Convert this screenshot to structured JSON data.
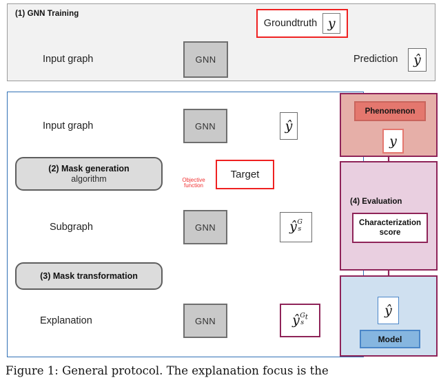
{
  "figure": {
    "caption": "Figure 1: General protocol. The explanation focus is the"
  },
  "panel1": {
    "title": "(1) GNN Training",
    "input_label": "Input graph",
    "gnn_label": "GNN",
    "groundtruth_label": "Groundtruth",
    "groundtruth_symbol": "y",
    "prediction_label": "Prediction",
    "prediction_symbol": "ŷ",
    "border_color": "#9a9a9a",
    "background": "#f2f2f2",
    "accent_color": "#ef2020"
  },
  "panel2": {
    "border_color": "#2f6fb5",
    "rows": [
      {
        "source_label": "Input graph",
        "gnn_label": "GNN",
        "output_symbol": "ŷ",
        "output_sup": ""
      },
      {
        "source_label": "Subgraph",
        "gnn_label": "GNN",
        "output_symbol": "ŷ",
        "output_sup": "G_s"
      },
      {
        "source_label": "Explanation",
        "gnn_label": "GNN",
        "output_symbol": "ŷ",
        "output_sup": "G_s^t"
      }
    ],
    "step2": {
      "title": "(2) Mask generation",
      "subtitle": "algorithm"
    },
    "step3": {
      "title": "(3) Mask transformation"
    },
    "target": {
      "label": "Target",
      "objective_line1": "Objective",
      "objective_line2": "function",
      "border_color": "#ef2020"
    }
  },
  "right_panels": {
    "phenomenon": {
      "title": "Phenomenon",
      "symbol": "y",
      "panel_color": "#e6afa8",
      "chip_color": "#e4776e",
      "border_color": "#8e2358"
    },
    "evaluation": {
      "title": "(4) Evaluation",
      "score_line1": "Characterization",
      "score_line2": "score",
      "panel_color": "#e9cfe0",
      "border_color": "#8e2358"
    },
    "model": {
      "title": "Model",
      "symbol": "ŷ",
      "panel_color": "#cfe0f0",
      "chip_color": "#86b6e0",
      "border_color": "#8e2358"
    }
  }
}
